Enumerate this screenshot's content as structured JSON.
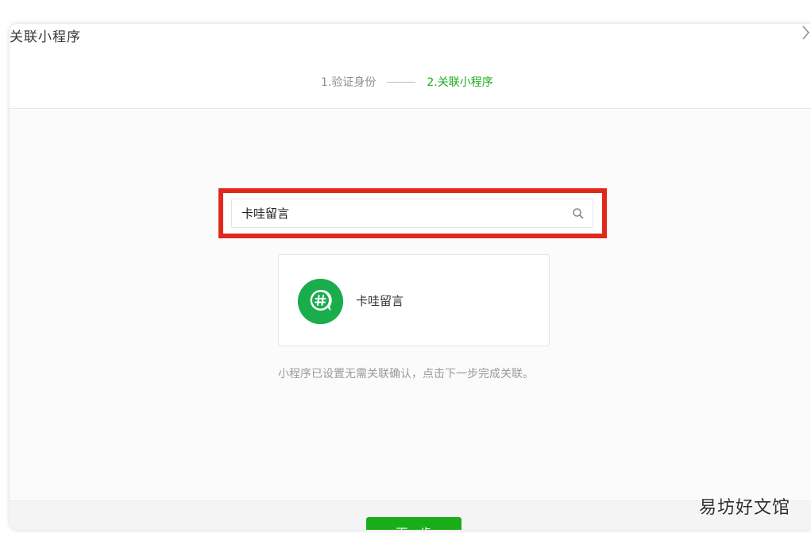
{
  "dialog": {
    "title": "关联小程序",
    "close_icon": "chevron-right-icon"
  },
  "steps": {
    "step1": "1.验证身份",
    "step2": "2.关联小程序",
    "active_color": "#1aad19",
    "inactive_color": "#8d8d8d"
  },
  "search": {
    "value": "卡哇留言",
    "icon": "search-icon",
    "highlight_color": "#e0291d"
  },
  "result": {
    "name": "卡哇留言",
    "icon": "miniprogram-hash-icon",
    "icon_color": "#19ad4b"
  },
  "hint": "小程序已设置无需关联确认，点击下一步完成关联。",
  "footer": {
    "next_label": "下一步",
    "button_color": "#1aad19"
  },
  "watermark": "易坊好文馆"
}
